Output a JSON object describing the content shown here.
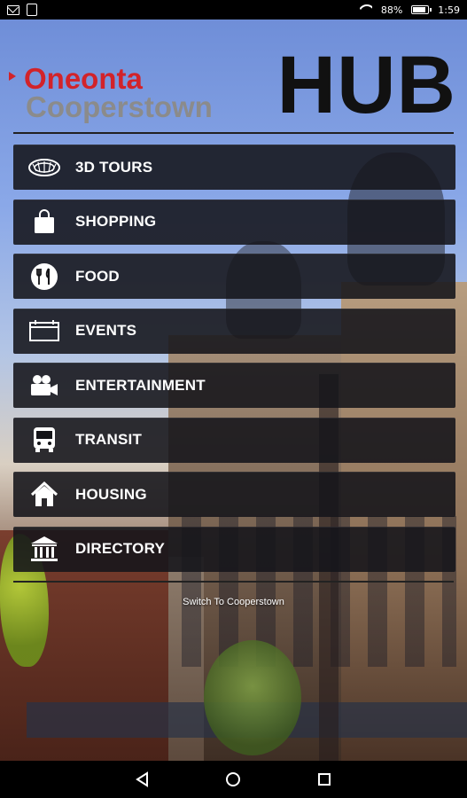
{
  "status_bar": {
    "battery": "88%",
    "time": "1:59",
    "icons": [
      "mail-icon",
      "bag-icon",
      "wifi-icon",
      "battery-icon"
    ]
  },
  "header": {
    "line1": "Oneonta",
    "line2": "Cooperstown",
    "hub": "HUB",
    "colors": {
      "line1": "#d2232a",
      "line2": "#8b8b8b",
      "hub": "#111111"
    }
  },
  "menu": {
    "items": [
      {
        "label": "3D TOURS",
        "icon": "tours-icon"
      },
      {
        "label": "SHOPPING",
        "icon": "shopping-bag-icon"
      },
      {
        "label": "FOOD",
        "icon": "food-icon"
      },
      {
        "label": "EVENTS",
        "icon": "events-icon"
      },
      {
        "label": "ENTERTAINMENT",
        "icon": "camera-icon"
      },
      {
        "label": "TRANSIT",
        "icon": "bus-icon"
      },
      {
        "label": "HOUSING",
        "icon": "house-icon"
      },
      {
        "label": "DIRECTORY",
        "icon": "directory-icon"
      }
    ]
  },
  "switch_link": "Switch To Cooperstown",
  "navbar": {
    "icons": [
      "back-icon",
      "home-icon",
      "recents-icon"
    ]
  }
}
